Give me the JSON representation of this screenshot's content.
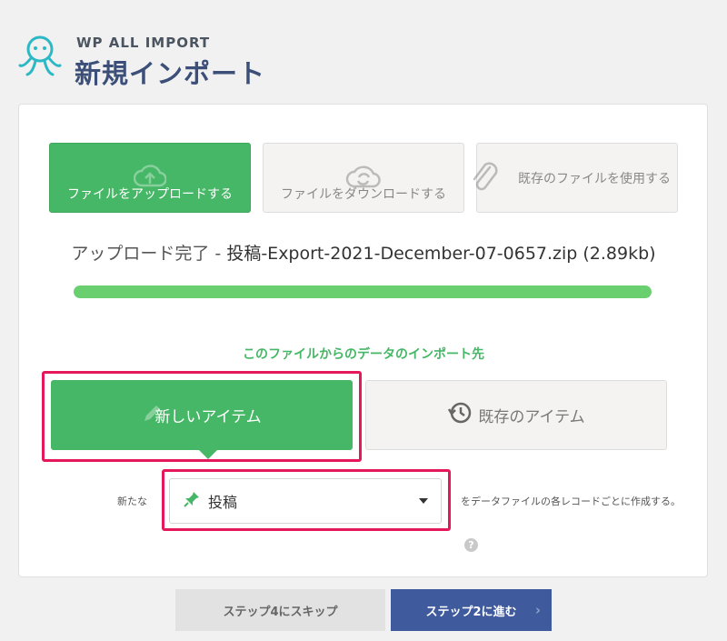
{
  "header": {
    "brand": "WP ALL IMPORT",
    "title": "新規インポート"
  },
  "source_buttons": [
    {
      "label": "ファイルをアップロードする",
      "icon": "cloud-upload-icon",
      "active": true
    },
    {
      "label": "ファイルをダウンロードする",
      "icon": "cloud-download-icon",
      "active": false
    },
    {
      "label": "既存のファイルを使用する",
      "icon": "paperclip-icon",
      "active": false
    }
  ],
  "upload": {
    "status_prefix": "アップロード完了 - ",
    "filename": "投稿-Export-2021-December-07-0657.zip (2.89kb)",
    "progress": 1.0
  },
  "target": {
    "heading": "このファイルからのデータのインポート先",
    "new_item_label": "新しいアイテム",
    "existing_item_label": "既存のアイテム"
  },
  "post_type": {
    "prefix_label": "新たな",
    "selected": "投稿",
    "suffix_label": "をデータファイルの各レコードごとに作成する。",
    "help": "?"
  },
  "footer": {
    "skip_label": "ステップ4にスキップ",
    "next_label": "ステップ2に進む",
    "next_chevron": "›"
  },
  "colors": {
    "accent_green": "#46b766",
    "progress_green": "#6acf6f",
    "primary_blue": "#3f5a9d",
    "highlight_red": "#e6185c"
  }
}
